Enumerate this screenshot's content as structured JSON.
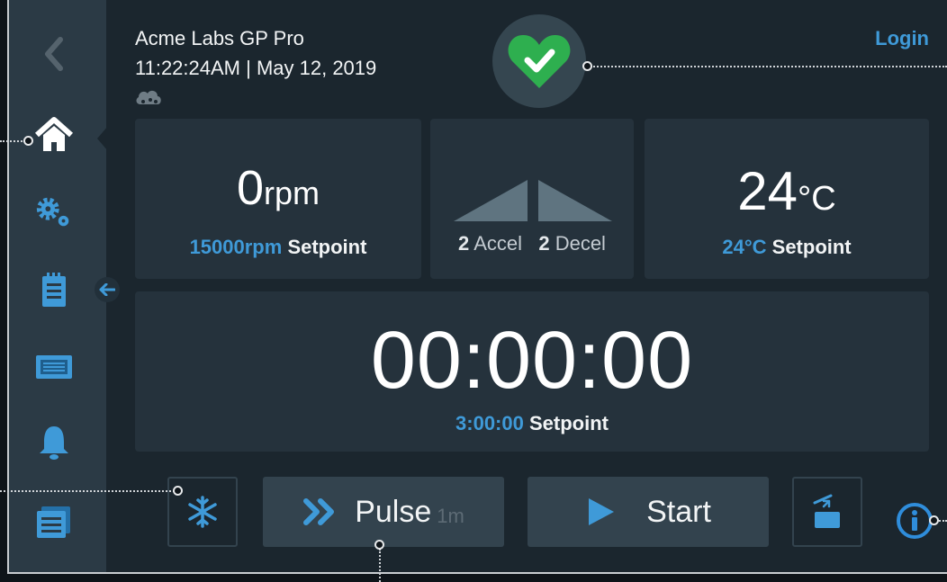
{
  "header": {
    "title": "Acme Labs GP Pro",
    "datetime": "11:22:24AM | May 12, 2019",
    "login_label": "Login",
    "status_icon": "heart-check-icon"
  },
  "sidebar": {
    "items": [
      "back",
      "home",
      "settings",
      "run-log",
      "display",
      "alarms",
      "programs"
    ]
  },
  "speed": {
    "value": "0",
    "unit": "rpm",
    "setpoint_value": "15000rpm",
    "setpoint_label": "Setpoint"
  },
  "ramp": {
    "accel_value": "2",
    "accel_label": "Accel",
    "decel_value": "2",
    "decel_label": "Decel"
  },
  "temperature": {
    "value": "24",
    "unit": "°C",
    "setpoint_value": "24°C",
    "setpoint_label": "Setpoint"
  },
  "timer": {
    "value": "00:00:00",
    "setpoint_value": "3:00:00",
    "setpoint_label": "Setpoint"
  },
  "controls": {
    "pulse_label": "Pulse",
    "pulse_sub": "1m",
    "start_label": "Start"
  },
  "colors": {
    "accent": "#3f9ad8",
    "status_green": "#2eaf4f"
  }
}
